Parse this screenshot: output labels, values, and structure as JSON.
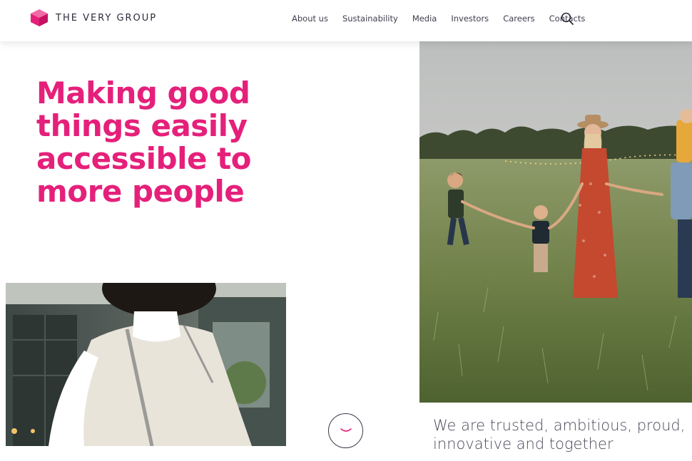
{
  "header": {
    "brand": "THE VERY GROUP",
    "nav": [
      "About us",
      "Sustainability",
      "Media",
      "Investors",
      "Careers",
      "Contacts"
    ]
  },
  "hero": {
    "lines": [
      "Making good",
      "things easily",
      "accessible to",
      "more people"
    ]
  },
  "values_text": {
    "line1": "We are trusted, ambitious, proud,",
    "line2": "innovative and together"
  },
  "icons": {
    "logo": "cube-logo-icon",
    "search": "search-icon",
    "scroll": "chevron-down-icon"
  },
  "colors": {
    "brand_pink": "#e5207a",
    "text_dark": "#3a3a4a"
  }
}
